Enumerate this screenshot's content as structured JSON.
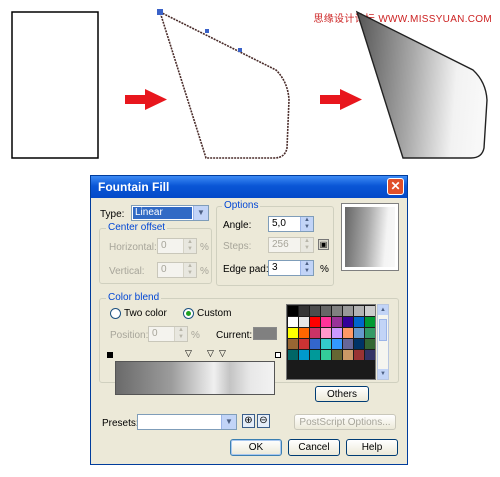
{
  "watermark": "思缘设计论坛 WWW.MISSYUAN.COM",
  "dialog": {
    "title": "Fountain Fill",
    "type_label": "Type:",
    "type_value": "Linear",
    "center_offset": {
      "title": "Center offset",
      "horizontal_label": "Horizontal:",
      "horizontal_value": "0",
      "vertical_label": "Vertical:",
      "vertical_value": "0",
      "unit": "%"
    },
    "options": {
      "title": "Options",
      "angle_label": "Angle:",
      "angle_value": "5,0",
      "steps_label": "Steps:",
      "steps_value": "256",
      "edge_pad_label": "Edge pad:",
      "edge_pad_value": "3",
      "edge_pad_unit": "%"
    },
    "color_blend": {
      "title": "Color blend",
      "two_color_label": "Two color",
      "custom_label": "Custom",
      "selected_mode": "Custom",
      "position_label": "Position:",
      "position_value": "0",
      "position_unit": "%",
      "current_label": "Current:",
      "current_color": "#808080",
      "others_label": "Others"
    },
    "palette_colors": [
      "#000000",
      "#333333",
      "#4d4d4d",
      "#666666",
      "#808080",
      "#999999",
      "#b3b3b3",
      "#cccccc",
      "#ffffff",
      "#e6e6e6",
      "#ff0000",
      "#ff3399",
      "#993399",
      "#330099",
      "#0066cc",
      "#009933",
      "#ffff00",
      "#ff6600",
      "#cc3366",
      "#ff99cc",
      "#cc99ff",
      "#ff9966",
      "#6699cc",
      "#339966",
      "#996633",
      "#cc3333",
      "#3366cc",
      "#33cccc",
      "#3399ff",
      "#666699",
      "#003366",
      "#336633",
      "#006666",
      "#0099cc",
      "#009999",
      "#33cc99",
      "#666633",
      "#cc9966",
      "#993333",
      "#333366"
    ],
    "presets_label": "Presets:",
    "presets_value": "",
    "postscript_label": "PostScript Options...",
    "ok_label": "OK",
    "cancel_label": "Cancel",
    "help_label": "Help"
  }
}
